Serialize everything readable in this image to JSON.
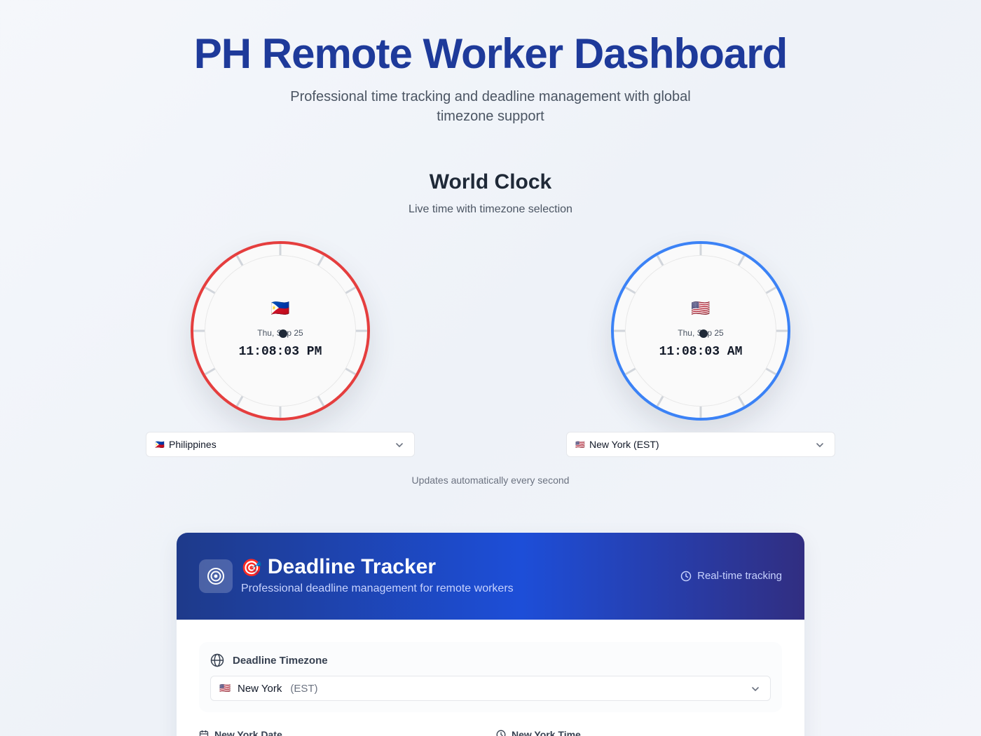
{
  "header": {
    "title": "PH Remote Worker Dashboard",
    "subtitle": "Professional time tracking and deadline management with global timezone support"
  },
  "world_clock": {
    "title": "World Clock",
    "subtitle": "Live time with timezone selection",
    "clocks": [
      {
        "flag": "🇵🇭",
        "date": "Thu, Sep 25",
        "time": "11:08:03 PM",
        "ring_color": "#e53e3e",
        "select_flag": "🇵🇭",
        "select_label": "Philippines"
      },
      {
        "flag": "🇺🇸",
        "date": "Thu, Sep 25",
        "time": "11:08:03 AM",
        "ring_color": "#3b82f6",
        "select_flag": "🇺🇸",
        "select_label": "New York (EST)"
      }
    ],
    "update_note": "Updates automatically every second"
  },
  "deadline_tracker": {
    "emoji": "🎯",
    "title": "Deadline Tracker",
    "subtitle": "Professional deadline management for remote workers",
    "realtime_label": "Real-time tracking",
    "timezone_label": "Deadline Timezone",
    "timezone_select": {
      "flag": "🇺🇸",
      "city": "New York",
      "abbr": "(EST)"
    },
    "date_label": "New York Date",
    "time_label": "New York Time"
  },
  "icons": {
    "target": "target-icon",
    "clock": "clock-icon",
    "globe": "globe-icon",
    "calendar": "calendar-icon",
    "chevron": "chevron-down-icon"
  }
}
